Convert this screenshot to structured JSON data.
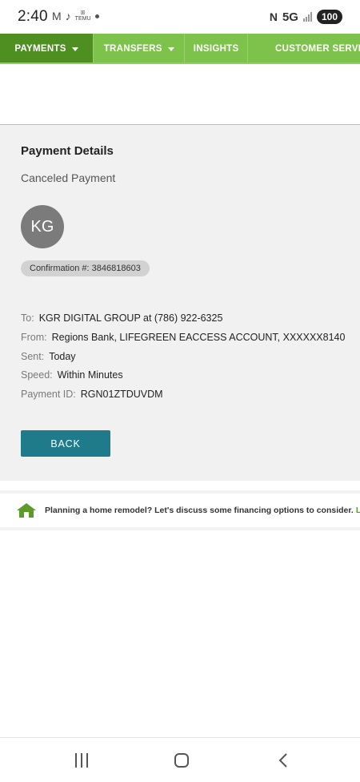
{
  "status_bar": {
    "time": "2:40",
    "network": "5G",
    "battery": "100",
    "icons": [
      "gmail-icon",
      "tiktok-icon",
      "temu-icon",
      "nfc-icon",
      "signal-icon"
    ]
  },
  "nav": {
    "items": [
      {
        "label": "PAYMENTS",
        "dropdown": true,
        "active": true
      },
      {
        "label": "TRANSFERS",
        "dropdown": true,
        "active": false
      },
      {
        "label": "INSIGHTS",
        "dropdown": false,
        "active": false
      },
      {
        "label": "CUSTOMER SERVIC",
        "dropdown": false,
        "active": false
      }
    ]
  },
  "payment": {
    "title": "Payment Details",
    "status": "Canceled Payment",
    "avatar_initials": "KG",
    "confirmation": "Confirmation #: 3846818603",
    "details": [
      {
        "label": "To:",
        "value": "KGR DIGITAL GROUP at (786) 922-6325"
      },
      {
        "label": "From:",
        "value": "Regions Bank, LIFEGREEN EACCESS ACCOUNT, XXXXXX8140"
      },
      {
        "label": "Sent:",
        "value": "Today"
      },
      {
        "label": "Speed:",
        "value": "Within Minutes"
      },
      {
        "label": "Payment ID:",
        "value": "RGN01ZTDUVDM"
      }
    ],
    "back_label": "BACK"
  },
  "promo": {
    "text": "Planning a home remodel? Let's discuss some financing options to consider.",
    "link": "Le"
  },
  "colors": {
    "nav_green": "#7dc24a",
    "nav_active": "#4f8f22",
    "button_teal": "#1f7a8a",
    "panel_bg": "#f1f1f2"
  }
}
